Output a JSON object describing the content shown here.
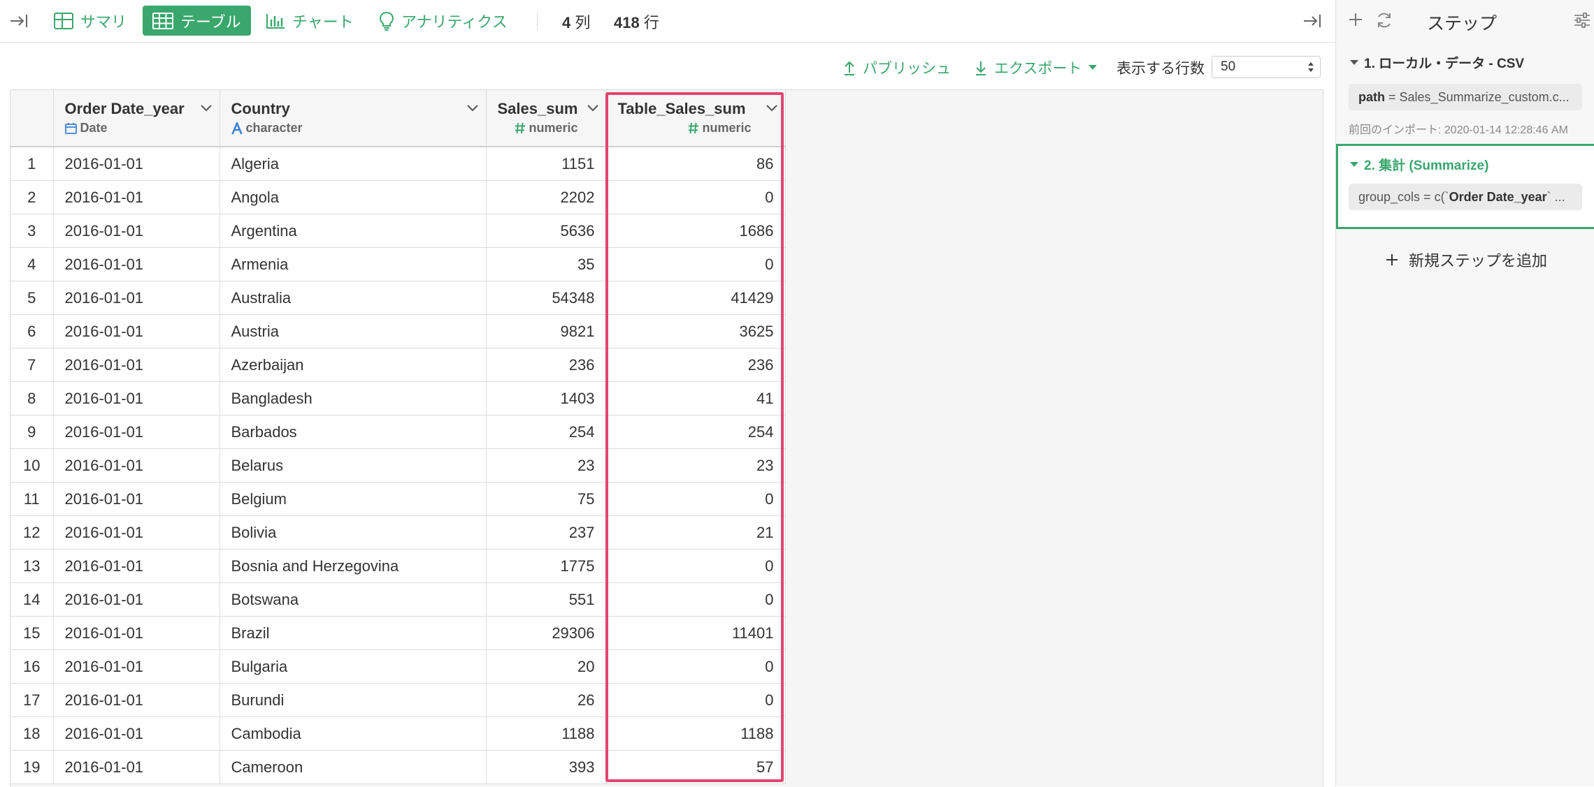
{
  "toolbar": {
    "tabs": [
      {
        "label": "サマリ",
        "icon": "summary-grid-icon"
      },
      {
        "label": "テーブル",
        "icon": "table-icon"
      },
      {
        "label": "チャート",
        "icon": "bar-chart-icon"
      },
      {
        "label": "アナリティクス",
        "icon": "lightbulb-icon"
      }
    ],
    "col_count": "4",
    "col_unit": "列",
    "row_count": "418",
    "row_unit": "行"
  },
  "actions": {
    "publish": "パブリッシュ",
    "export": "エクスポート",
    "rows_label": "表示する行数",
    "rows_value": "50"
  },
  "table": {
    "columns": [
      {
        "name": "Order Date_year",
        "type": "Date",
        "type_icon": "calendar-icon"
      },
      {
        "name": "Country",
        "type": "character",
        "type_icon": "character-type-icon"
      },
      {
        "name": "Sales_sum",
        "type": "numeric",
        "type_icon": "hash-icon"
      },
      {
        "name": "Table_Sales_sum",
        "type": "numeric",
        "type_icon": "hash-icon"
      }
    ],
    "rows": [
      [
        "1",
        "2016-01-01",
        "Algeria",
        "1151",
        "86"
      ],
      [
        "2",
        "2016-01-01",
        "Angola",
        "2202",
        "0"
      ],
      [
        "3",
        "2016-01-01",
        "Argentina",
        "5636",
        "1686"
      ],
      [
        "4",
        "2016-01-01",
        "Armenia",
        "35",
        "0"
      ],
      [
        "5",
        "2016-01-01",
        "Australia",
        "54348",
        "41429"
      ],
      [
        "6",
        "2016-01-01",
        "Austria",
        "9821",
        "3625"
      ],
      [
        "7",
        "2016-01-01",
        "Azerbaijan",
        "236",
        "236"
      ],
      [
        "8",
        "2016-01-01",
        "Bangladesh",
        "1403",
        "41"
      ],
      [
        "9",
        "2016-01-01",
        "Barbados",
        "254",
        "254"
      ],
      [
        "10",
        "2016-01-01",
        "Belarus",
        "23",
        "23"
      ],
      [
        "11",
        "2016-01-01",
        "Belgium",
        "75",
        "0"
      ],
      [
        "12",
        "2016-01-01",
        "Bolivia",
        "237",
        "21"
      ],
      [
        "13",
        "2016-01-01",
        "Bosnia and Herzegovina",
        "1775",
        "0"
      ],
      [
        "14",
        "2016-01-01",
        "Botswana",
        "551",
        "0"
      ],
      [
        "15",
        "2016-01-01",
        "Brazil",
        "29306",
        "11401"
      ],
      [
        "16",
        "2016-01-01",
        "Bulgaria",
        "20",
        "0"
      ],
      [
        "17",
        "2016-01-01",
        "Burundi",
        "26",
        "0"
      ],
      [
        "18",
        "2016-01-01",
        "Cambodia",
        "1188",
        "1188"
      ],
      [
        "19",
        "2016-01-01",
        "Cameroon",
        "393",
        "57"
      ]
    ]
  },
  "panel": {
    "title": "ステップ",
    "step1": {
      "title": "1. ローカル・データ - CSV",
      "param_key": "path",
      "param_value": "= Sales_Summarize_custom.c...",
      "meta": "前回のインポート: 2020-01-14 12:28:46 AM"
    },
    "step2": {
      "title": "2. 集計 (Summarize)",
      "param_prefix": "group_cols = c(`",
      "param_bold": "Order Date_year",
      "param_suffix": "` ..."
    },
    "add_step": "新規ステップを追加"
  },
  "colors": {
    "accent": "#3aa76d",
    "highlight": "#e0466e",
    "date_icon": "#3b82d6"
  }
}
